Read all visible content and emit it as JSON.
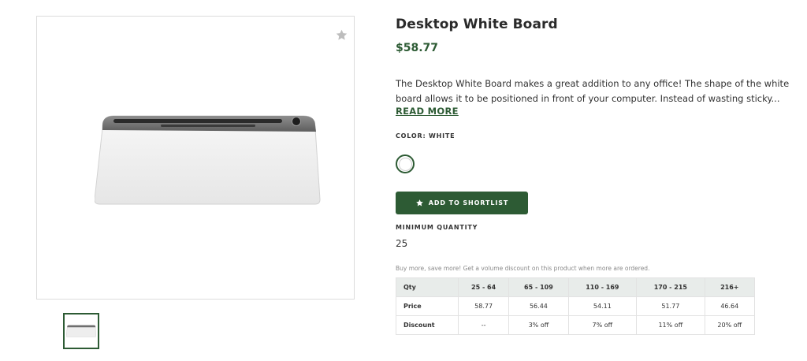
{
  "product": {
    "title": "Desktop White Board",
    "price": "$58.77",
    "description_lines": [
      "The Desktop White Board makes a great addition to any office! The shape of the white",
      "board allows it to be positioned in front of your computer. Instead of wasting sticky..."
    ],
    "read_more": "READ MORE",
    "image_icon": "whiteboard-product-image",
    "thumbnail_icon": "whiteboard-thumbnail"
  },
  "favorite": {
    "icon": "star-icon"
  },
  "color": {
    "label": "COLOR: WHITE",
    "swatch": "#ffffff"
  },
  "shortlist": {
    "label": "ADD TO SHORTLIST",
    "icon": "star-icon"
  },
  "min_quantity": {
    "label": "MINIMUM QUANTITY",
    "value": "25"
  },
  "volume": {
    "note": "Buy more, save more! Get a volume discount on this product when more are ordered.",
    "headers": [
      "Qty",
      "25 - 64",
      "65 - 109",
      "110 - 169",
      "170 - 215",
      "216+"
    ],
    "rows": [
      [
        "Price",
        "58.77",
        "56.44",
        "54.11",
        "51.77",
        "46.64"
      ],
      [
        "Discount",
        "--",
        "3% off",
        "7% off",
        "11% off",
        "20% off"
      ]
    ]
  },
  "colors": {
    "accent": "#2d5b34",
    "table_header_bg": "#e8ecea"
  }
}
